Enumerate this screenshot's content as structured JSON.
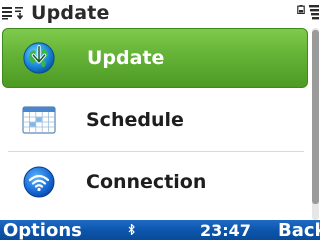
{
  "title_bar": {
    "title": "Update",
    "menu_icon": "options-menu-icon",
    "sort_icon": "sort-icon",
    "battery_icon": "battery-icon",
    "signal_icon": "signal-strength-icon"
  },
  "menu": {
    "items": [
      {
        "label": "Update",
        "icon": "update-globe-icon",
        "selected": true
      },
      {
        "label": "Schedule",
        "icon": "calendar-icon",
        "selected": false
      },
      {
        "label": "Connection",
        "icon": "wifi-icon",
        "selected": false
      }
    ]
  },
  "softkeys": {
    "left": "Options",
    "status_icon": "bluetooth-icon",
    "time": "23:47",
    "right": "Back"
  },
  "colors": {
    "selection": "#64b336",
    "softkey_bar": "#0d56ad",
    "text": "#1e1e1e"
  }
}
